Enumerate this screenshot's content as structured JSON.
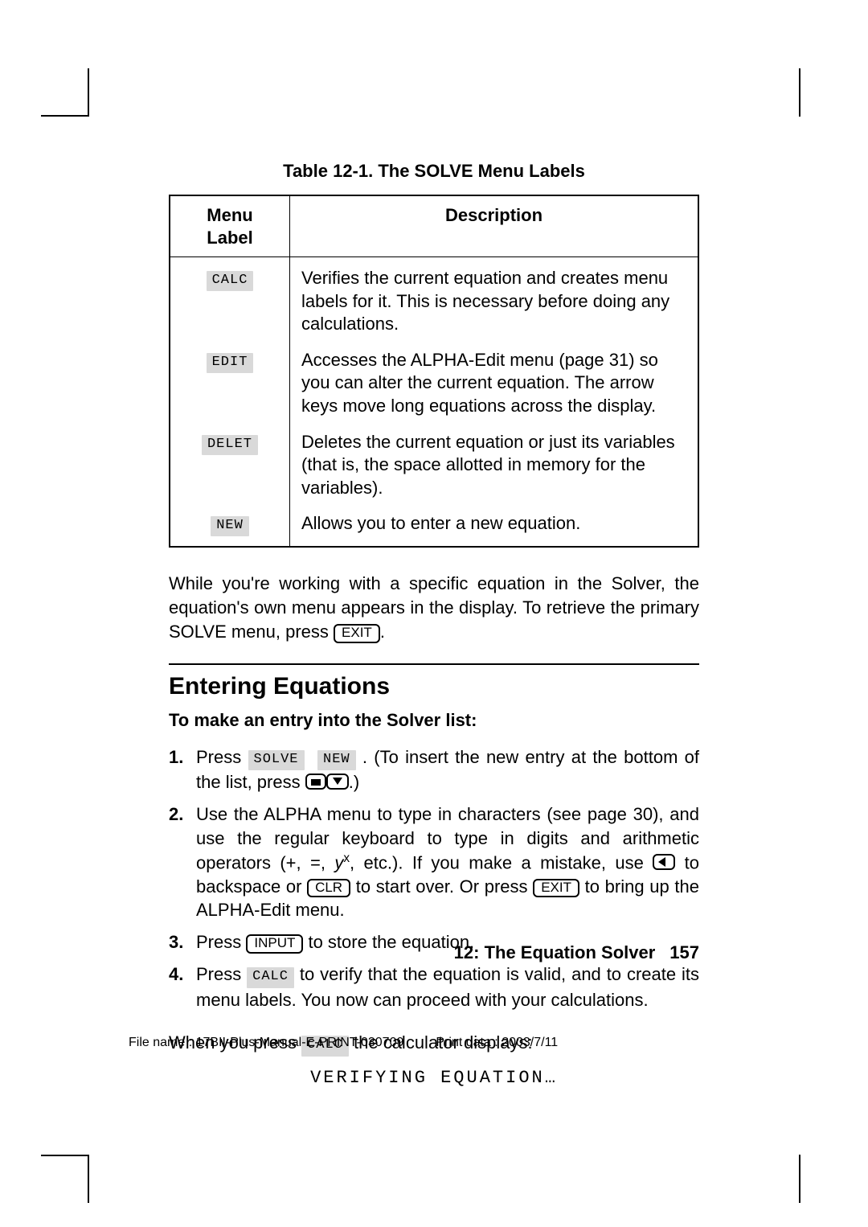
{
  "table": {
    "caption": "Table 12-1. The SOLVE Menu Labels",
    "head_label": "Menu Label",
    "head_desc": "Description",
    "rows": [
      {
        "label": "CALC",
        "desc": "Verifies the current equation and creates menu labels for it. This is necessary before doing any calculations."
      },
      {
        "label": "EDIT",
        "desc": "Accesses the ALPHA-Edit menu (page 31) so you can alter the current equation. The arrow keys move long equations across the display."
      },
      {
        "label": "DELET",
        "desc": "Deletes the current equation or just its variables (that is, the space allotted in memory for the variables)."
      },
      {
        "label": "NEW",
        "desc": "Allows you to enter a new equation."
      }
    ]
  },
  "para1_a": "While you're working with a specific equation in the Solver, the equation's own menu appears in the display. To retrieve the primary SOLVE menu, press ",
  "para1_b": ".",
  "exit_key": "EXIT",
  "section_heading": "Entering Equations",
  "subheading": "To make an entry into the Solver list:",
  "steps": {
    "s1_a": "Press ",
    "s1_solve": "SOLVE",
    "s1_new": "NEW",
    "s1_b": " . (To insert the new entry at the bottom of the list, press ",
    "s1_c": ".)",
    "s2_a": "Use the ALPHA menu to type in characters (see page 30), and use the regular keyboard to type in digits and arithmetic operators (+, =, ",
    "s2_yx": "y",
    "s2_b": ", etc.). If you make a mistake, use ",
    "s2_c": " to backspace or ",
    "s2_clr": "CLR",
    "s2_d": " to start over. Or press ",
    "s2_exit": "EXIT",
    "s2_e": " to bring up the ALPHA-Edit menu.",
    "s3_a": "Press ",
    "s3_input": "INPUT",
    "s3_b": " to store the equation.",
    "s4_a": "Press ",
    "s4_calc": "CALC",
    "s4_b": " to verify that the equation is valid, and to create its menu labels. You now can proceed with your calculations."
  },
  "post_a": "When you press ",
  "post_calc": "CALC",
  "post_b": " the calculator displays:",
  "lcd_line": "VERIFYING EQUATION…",
  "footer_chapter": "12: The Equation Solver",
  "footer_page": "157",
  "file_a": "File name : 17BII-Plus-Manual-E-PRINT-030709",
  "file_b": "Print data : 2003/7/11"
}
